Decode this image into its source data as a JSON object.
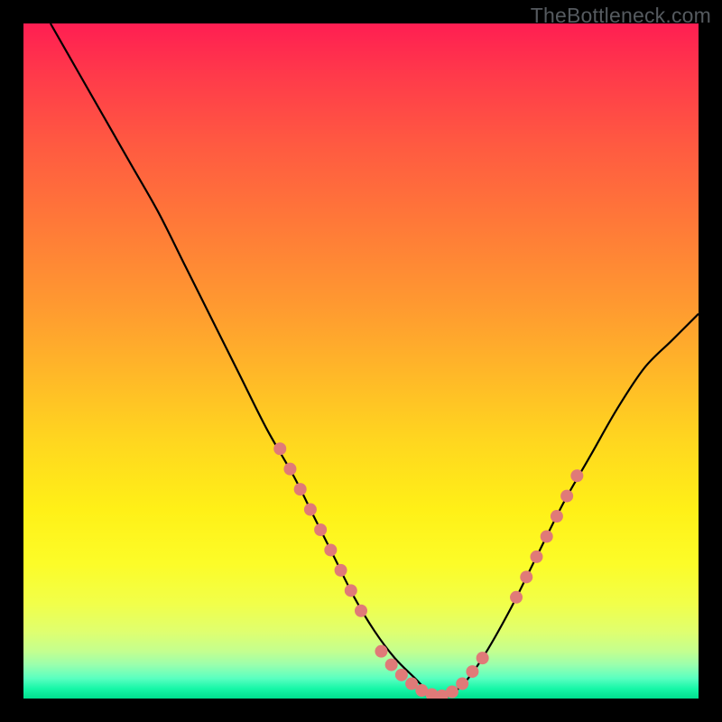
{
  "watermark": "TheBottleneck.com",
  "colors": {
    "background": "#000000",
    "curve_stroke": "#000000",
    "marker_fill": "#e07a78",
    "watermark_text": "#555a5f"
  },
  "chart_data": {
    "type": "line",
    "title": "",
    "xlabel": "",
    "ylabel": "",
    "xlim": [
      0,
      100
    ],
    "ylim": [
      0,
      100
    ],
    "grid": false,
    "series": [
      {
        "name": "bottleneck-curve",
        "x": [
          4,
          8,
          12,
          16,
          20,
          24,
          28,
          32,
          36,
          40,
          43,
          46,
          49,
          52,
          55,
          58,
          60,
          62,
          65,
          68,
          72,
          76,
          80,
          84,
          88,
          92,
          96,
          100
        ],
        "values": [
          100,
          93,
          86,
          79,
          72,
          64,
          56,
          48,
          40,
          33,
          27,
          21,
          15,
          10,
          6,
          3,
          1,
          0,
          2,
          6,
          13,
          21,
          29,
          36,
          43,
          49,
          53,
          57
        ]
      }
    ],
    "markers": [
      {
        "name": "left-cluster",
        "x": [
          38,
          39.5,
          41,
          42.5,
          44,
          45.5,
          47,
          48.5,
          50
        ],
        "values": [
          37,
          34,
          31,
          28,
          25,
          22,
          19,
          16,
          13
        ]
      },
      {
        "name": "valley-cluster",
        "x": [
          53,
          54.5,
          56,
          57.5,
          59,
          60.5,
          62,
          63.5,
          65,
          66.5,
          68
        ],
        "values": [
          7,
          5,
          3.5,
          2.2,
          1.2,
          0.6,
          0.4,
          1.0,
          2.2,
          4,
          6
        ]
      },
      {
        "name": "right-cluster",
        "x": [
          73,
          74.5,
          76,
          77.5,
          79,
          80.5,
          82
        ],
        "values": [
          15,
          18,
          21,
          24,
          27,
          30,
          33
        ]
      }
    ]
  }
}
